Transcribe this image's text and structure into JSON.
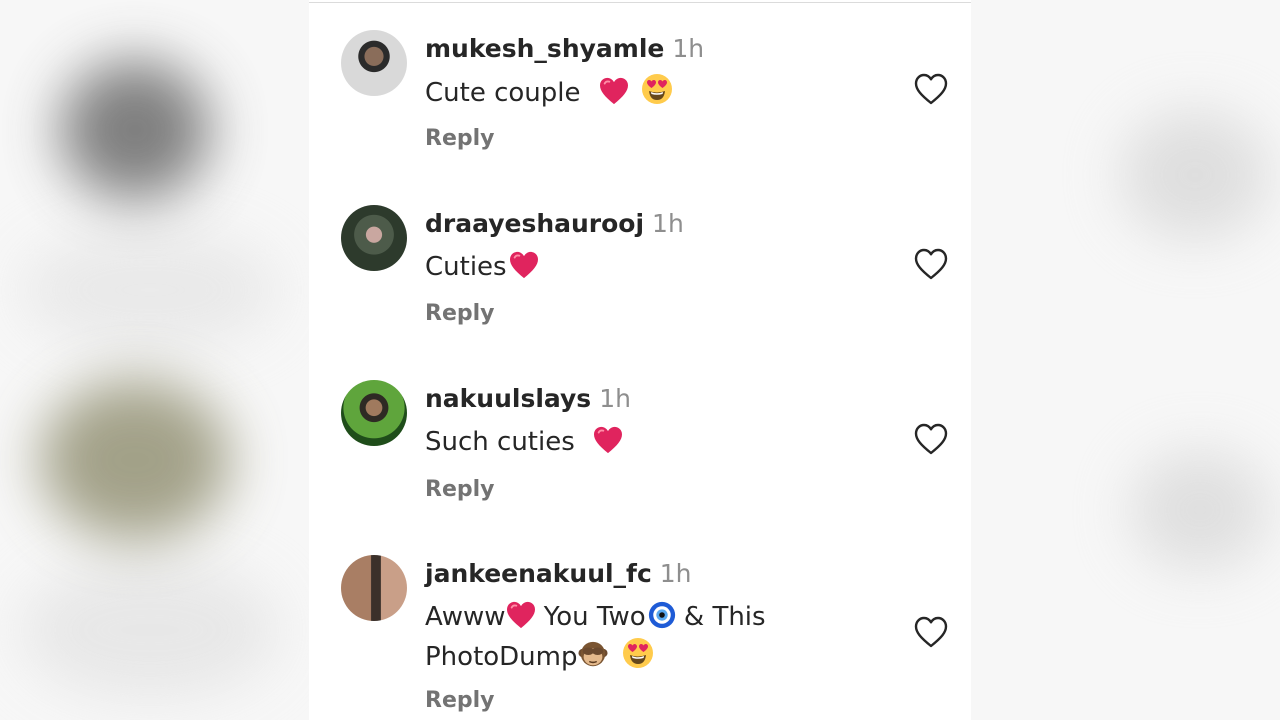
{
  "comments": [
    {
      "username": "mukesh_shyamle",
      "time": "1h",
      "text": "Cute couple",
      "reply_label": "Reply"
    },
    {
      "username": "draayeshaurooj",
      "time": "1h",
      "text": "Cuties",
      "reply_label": "Reply"
    },
    {
      "username": "nakuulslays",
      "time": "1h",
      "text": "Such cuties",
      "reply_label": "Reply"
    },
    {
      "username": "jankeenakuul_fc",
      "time": "1h",
      "text_part1": "Awww",
      "text_part2": "You Two",
      "text_part3": "& This",
      "text_part4": "PhotoDump",
      "reply_label": "Reply"
    }
  ],
  "icons": {
    "like": "heart-outline-icon",
    "red_heart": "red-heart-emoji",
    "heart_eyes": "heart-eyes-emoji",
    "evil_eye": "nazar-amulet-emoji",
    "monkey": "see-no-evil-monkey-emoji"
  },
  "colors": {
    "username": "#262626",
    "time": "#8e8e8e",
    "reply": "#737373",
    "red_heart": "#e0245e"
  }
}
